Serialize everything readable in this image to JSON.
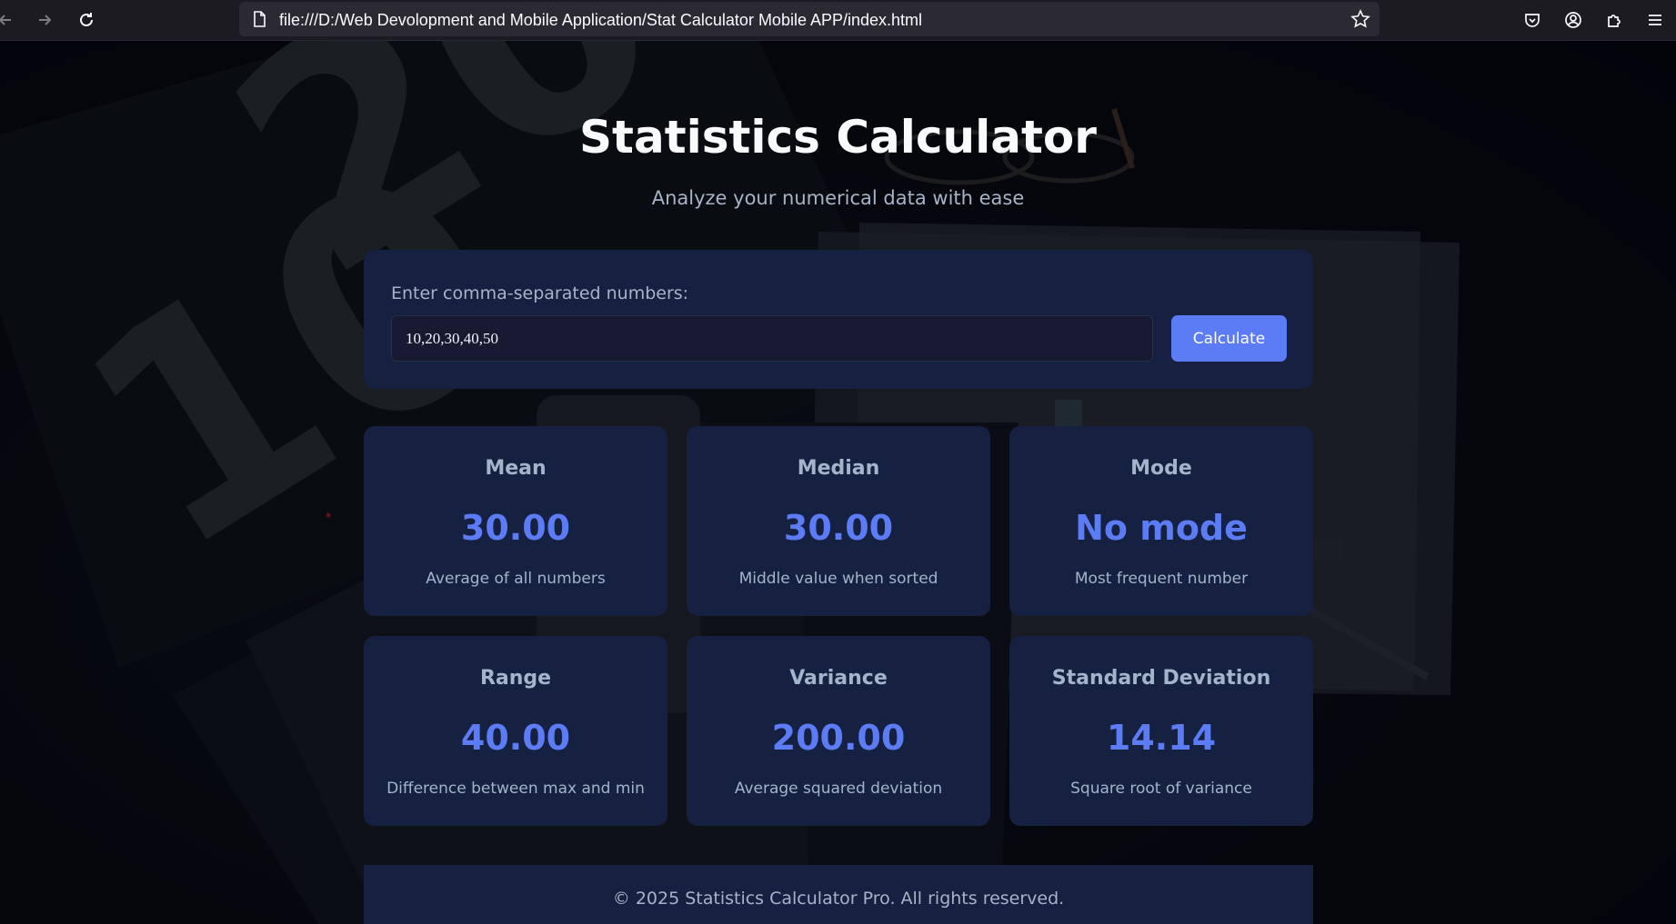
{
  "browser": {
    "url": "file:///D:/Web Devolopment and Mobile Application/Stat Calculator Mobile APP/index.html"
  },
  "app": {
    "title": "Statistics Calculator",
    "subtitle": "Analyze your numerical data with ease"
  },
  "input": {
    "label": "Enter comma-separated numbers:",
    "value": "10,20,30,40,50",
    "button_label": "Calculate"
  },
  "stats": [
    {
      "name": "Mean",
      "value": "30.00",
      "description": "Average of all numbers"
    },
    {
      "name": "Median",
      "value": "30.00",
      "description": "Middle value when sorted"
    },
    {
      "name": "Mode",
      "value": "No mode",
      "description": "Most frequent number"
    },
    {
      "name": "Range",
      "value": "40.00",
      "description": "Difference between max and min"
    },
    {
      "name": "Variance",
      "value": "200.00",
      "description": "Average squared deviation"
    },
    {
      "name": "Standard Deviation",
      "value": "14.14",
      "description": "Square root of variance"
    }
  ],
  "footer": {
    "text": "© 2025 Statistics Calculator Pro. All rights reserved."
  },
  "colors": {
    "accent": "#5b7cf5",
    "card": "#162040",
    "muted_text": "#a3b4cb"
  }
}
